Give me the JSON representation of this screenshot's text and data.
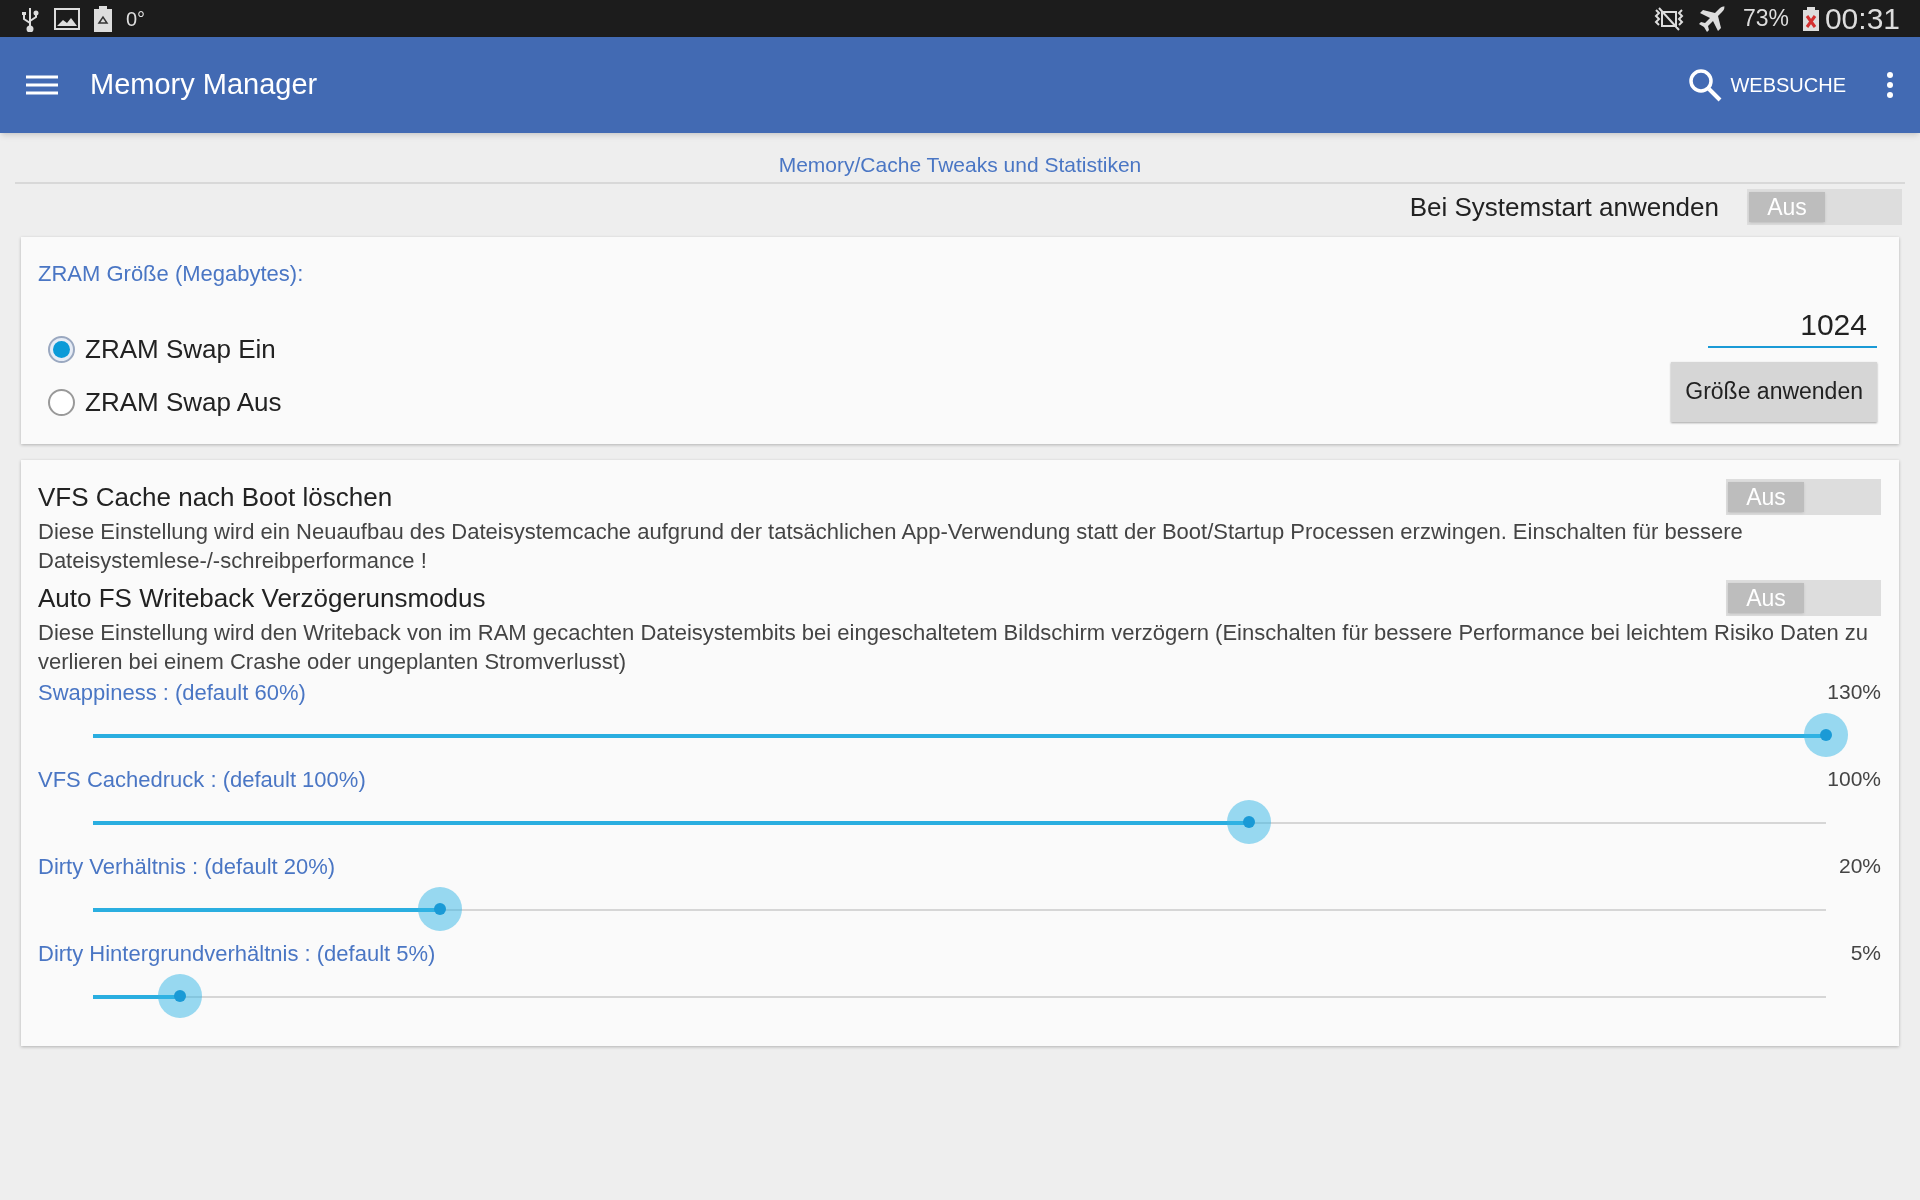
{
  "status_bar": {
    "temperature": "0°",
    "battery": "73%",
    "time": "00:31"
  },
  "app_bar": {
    "title": "Memory Manager",
    "search_label": "WEBSUCHE"
  },
  "subtitle": "Memory/Cache Tweaks und Statistiken",
  "boot_setting": {
    "label": "Bei Systemstart anwenden",
    "toggle": {
      "label": "Aus",
      "on": false
    }
  },
  "zram": {
    "label": "ZRAM Größe (Megabytes):",
    "size_value": "1024",
    "apply_button": "Größe anwenden",
    "options": [
      {
        "label": "ZRAM Swap Ein",
        "selected": true
      },
      {
        "label": "ZRAM Swap Aus",
        "selected": false
      }
    ]
  },
  "settings": [
    {
      "title": "VFS Cache nach Boot löschen",
      "description": "Diese Einstellung wird ein Neuaufbau des Dateisystemcache aufgrund der tatsächlichen App-Verwendung statt der Boot/Startup Processen erzwingen. Einschalten für bessere Dateisystemlese-/-schreibperformance !",
      "toggle": {
        "label": "Aus",
        "on": false
      }
    },
    {
      "title": "Auto FS Writeback Verzögerunsmodus",
      "description": "Diese Einstellung wird den Writeback von im RAM gecachten Dateisystembits bei eingeschaltetem Bildschirm verzögern (Einschalten für bessere Performance bei leichtem Risiko Daten zu verlieren bei einem Crashe oder ungeplanten Stromverlusst)",
      "toggle": {
        "label": "Aus",
        "on": false
      }
    }
  ],
  "sliders": [
    {
      "label": "Swappiness : (default 60%)",
      "reading": "130%",
      "level": 1.0
    },
    {
      "label": "VFS Cachedruck : (default 100%)",
      "reading": "100%",
      "level": 0.667
    },
    {
      "label": "Dirty Verhältnis : (default 20%)",
      "reading": "20%",
      "level": 0.2
    },
    {
      "label": "Dirty Hintergrundverhältnis : (default 5%)",
      "reading": "5%",
      "level": 0.05
    }
  ]
}
